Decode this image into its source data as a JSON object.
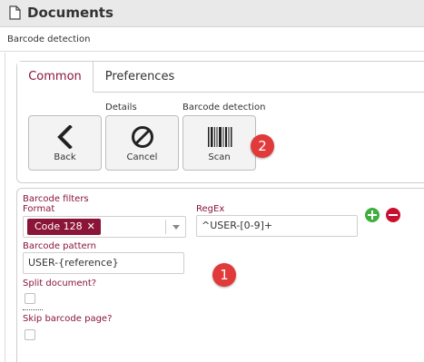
{
  "header": {
    "title": "Documents",
    "icon": "document-icon"
  },
  "panel": {
    "title": "Barcode detection"
  },
  "tabs": [
    {
      "label": "Common",
      "active": true
    },
    {
      "label": "Preferences",
      "active": false
    }
  ],
  "toolbar": {
    "groups": {
      "details": "Details",
      "barcode_detection": "Barcode detection"
    },
    "buttons": {
      "back": "Back",
      "cancel": "Cancel",
      "scan": "Scan"
    }
  },
  "badges": {
    "scan": "2",
    "pattern": "1"
  },
  "form": {
    "filters_title": "Barcode filters",
    "format_label": "Format",
    "format_selected": "Code 128",
    "chip_remove": "✕",
    "regex_label": "RegEx",
    "regex_value": "^USER-[0-9]+",
    "pattern_label": "Barcode pattern",
    "pattern_value": "USER-{reference}",
    "split_label": "Split document?",
    "split_checked": false,
    "skip_label": "Skip barcode page?",
    "skip_checked": false
  },
  "colors": {
    "accent": "#8b1538",
    "add": "#3fae3f",
    "remove": "#c8102e",
    "badge": "#e03a3a"
  }
}
